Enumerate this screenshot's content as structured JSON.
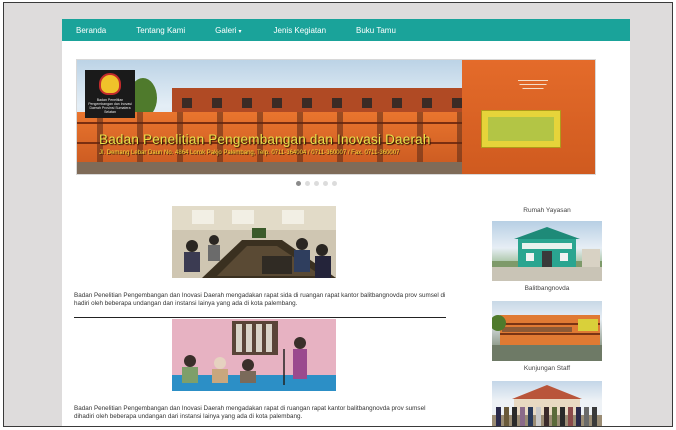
{
  "nav": {
    "items": [
      "Beranda",
      "Tentang Kami",
      "Galeri",
      "Jenis Kegiatan",
      "Buku Tamu"
    ]
  },
  "slider": {
    "title": "Badan Penelitian Pengembangan dan Inovasi Daerah",
    "subtitle": "Jl. Demang Lebar Daun No. 4864 Lorok Pakjo Palembang, Telp. 0711-364004 / 0711-360007 / Fax. 0711-360007",
    "logo_text": "Badan Penelitian Pengembangan dan Inovasi Daerah Provinsi Sumatera Selatan",
    "slide_count": 5,
    "active_slide": 1
  },
  "news": [
    {
      "text": "Badan Penelitian Pengembangan dan Inovasi Daerah mengadakan rapat sida di ruangan rapat kantor balitbangnovda prov sumsel di hadiri oleh beberapa undangan dan instansi lainya yang ada di kota palembang."
    },
    {
      "text": "Badan Penelitian Pengembangan dan Inovasi Daerah mengadakan rapat di ruangan rapat kantor balitbangnovda prov sumsel dihadiri oleh beberapa undangan dari instansi lainya yang ada di kota palembang."
    }
  ],
  "sidebar": {
    "heading": "Rumah Yayasan",
    "items": [
      {
        "label": "Balitbangnovda"
      },
      {
        "label": "Kunjungan Staff"
      }
    ]
  },
  "colors": {
    "nav_bg": "#1aa39a",
    "building_orange": "#e9752e",
    "title_yellow": "#e8e04a"
  }
}
